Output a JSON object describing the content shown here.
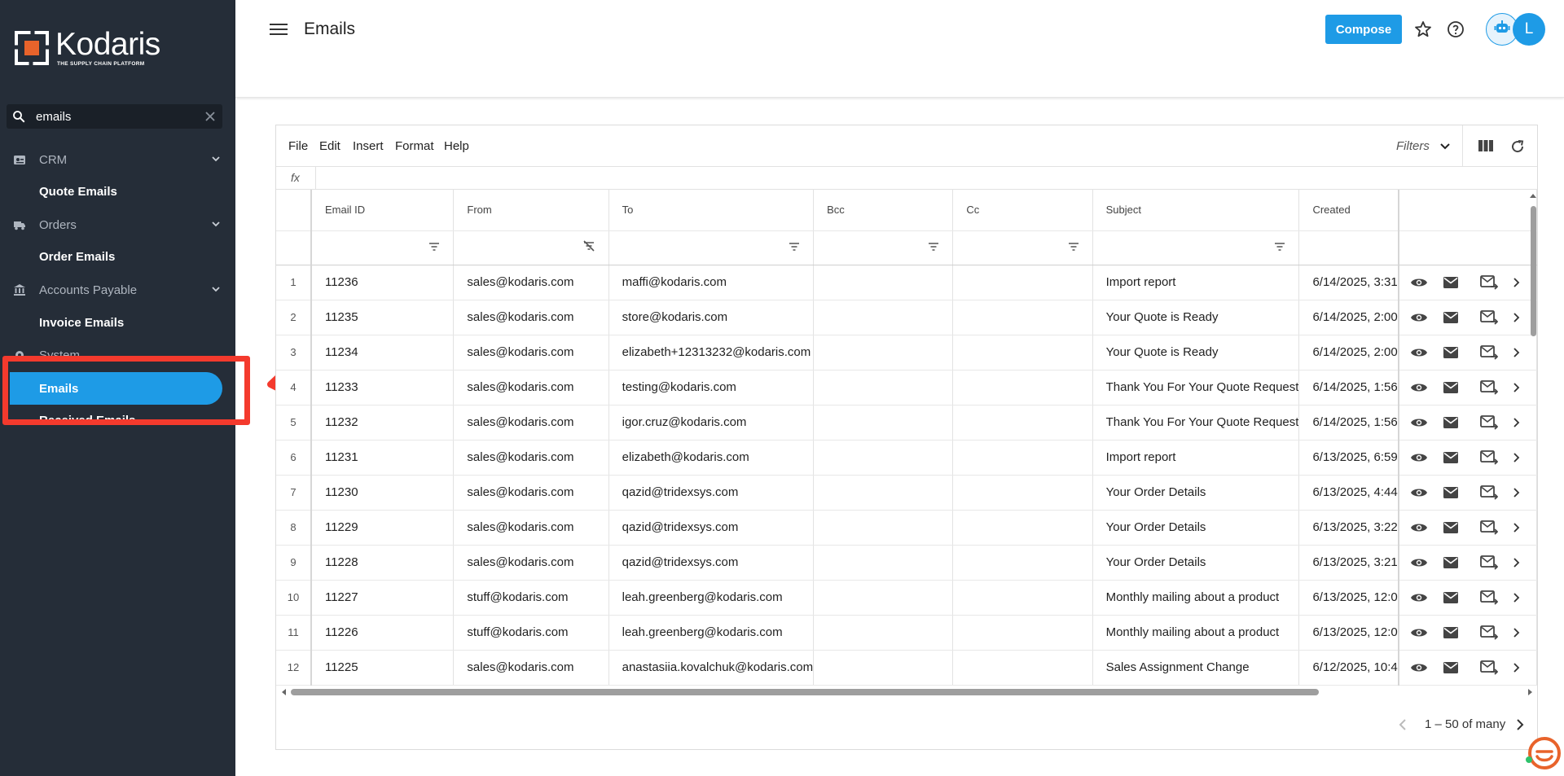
{
  "brand": {
    "name": "Kodaris",
    "tagline": "THE SUPPLY CHAIN PLATFORM"
  },
  "search": {
    "value": "emails",
    "placeholder": ""
  },
  "sidebar": {
    "groups": [
      {
        "label": "CRM",
        "icon": "badge-icon",
        "sub": "Quote Emails"
      },
      {
        "label": "Orders",
        "icon": "truck-icon",
        "sub": "Order Emails"
      },
      {
        "label": "Accounts Payable",
        "icon": "bank-icon",
        "sub": "Invoice Emails"
      },
      {
        "label": "System",
        "icon": "gear-icon"
      }
    ],
    "active": "Emails",
    "next_item": "Received Emails"
  },
  "header": {
    "title": "Emails",
    "compose_label": "Compose",
    "avatar_letter": "L"
  },
  "menu": [
    "File",
    "Edit",
    "Insert",
    "Format",
    "Help"
  ],
  "toolbar": {
    "filters_label": "Filters"
  },
  "formula": {
    "fx_label": "fx"
  },
  "columns": [
    "Email ID",
    "From",
    "To",
    "Bcc",
    "Cc",
    "Subject",
    "Created"
  ],
  "rows": [
    {
      "n": "1",
      "id": "11236",
      "from": "sales@kodaris.com",
      "to": "maffi@kodaris.com",
      "bcc": "",
      "cc": "",
      "subject": "Import report",
      "created": "6/14/2025, 3:31"
    },
    {
      "n": "2",
      "id": "11235",
      "from": "sales@kodaris.com",
      "to": "store@kodaris.com",
      "bcc": "",
      "cc": "",
      "subject": "Your Quote is Ready",
      "created": "6/14/2025, 2:00"
    },
    {
      "n": "3",
      "id": "11234",
      "from": "sales@kodaris.com",
      "to": "elizabeth+12313232@kodaris.com",
      "bcc": "",
      "cc": "",
      "subject": "Your Quote is Ready",
      "created": "6/14/2025, 2:00"
    },
    {
      "n": "4",
      "id": "11233",
      "from": "sales@kodaris.com",
      "to": "testing@kodaris.com",
      "bcc": "",
      "cc": "",
      "subject": "Thank You For Your Quote Request",
      "created": "6/14/2025, 1:56"
    },
    {
      "n": "5",
      "id": "11232",
      "from": "sales@kodaris.com",
      "to": "igor.cruz@kodaris.com",
      "bcc": "",
      "cc": "",
      "subject": "Thank You For Your Quote Request",
      "created": "6/14/2025, 1:56"
    },
    {
      "n": "6",
      "id": "11231",
      "from": "sales@kodaris.com",
      "to": "elizabeth@kodaris.com",
      "bcc": "",
      "cc": "",
      "subject": "Import report",
      "created": "6/13/2025, 6:59"
    },
    {
      "n": "7",
      "id": "11230",
      "from": "sales@kodaris.com",
      "to": "qazid@tridexsys.com",
      "bcc": "",
      "cc": "",
      "subject": "Your Order Details",
      "created": "6/13/2025, 4:44"
    },
    {
      "n": "8",
      "id": "11229",
      "from": "sales@kodaris.com",
      "to": "qazid@tridexsys.com",
      "bcc": "",
      "cc": "",
      "subject": "Your Order Details",
      "created": "6/13/2025, 3:22"
    },
    {
      "n": "9",
      "id": "11228",
      "from": "sales@kodaris.com",
      "to": "qazid@tridexsys.com",
      "bcc": "",
      "cc": "",
      "subject": "Your Order Details",
      "created": "6/13/2025, 3:21"
    },
    {
      "n": "10",
      "id": "11227",
      "from": "stuff@kodaris.com",
      "to": "leah.greenberg@kodaris.com",
      "bcc": "",
      "cc": "",
      "subject": "Monthly mailing about a product",
      "created": "6/13/2025, 12:0"
    },
    {
      "n": "11",
      "id": "11226",
      "from": "stuff@kodaris.com",
      "to": "leah.greenberg@kodaris.com",
      "bcc": "",
      "cc": "",
      "subject": "Monthly mailing about a product",
      "created": "6/13/2025, 12:0"
    },
    {
      "n": "12",
      "id": "11225",
      "from": "sales@kodaris.com",
      "to": "anastasiia.kovalchuk@kodaris.com",
      "bcc": "",
      "cc": "",
      "subject": "Sales Assignment Change",
      "created": "6/12/2025, 10:4"
    }
  ],
  "pager": {
    "range": "1 – 50 of many"
  },
  "colors": {
    "sidebar": "#252d38",
    "accent": "#1e9be6",
    "annotation": "#f43a2d"
  }
}
